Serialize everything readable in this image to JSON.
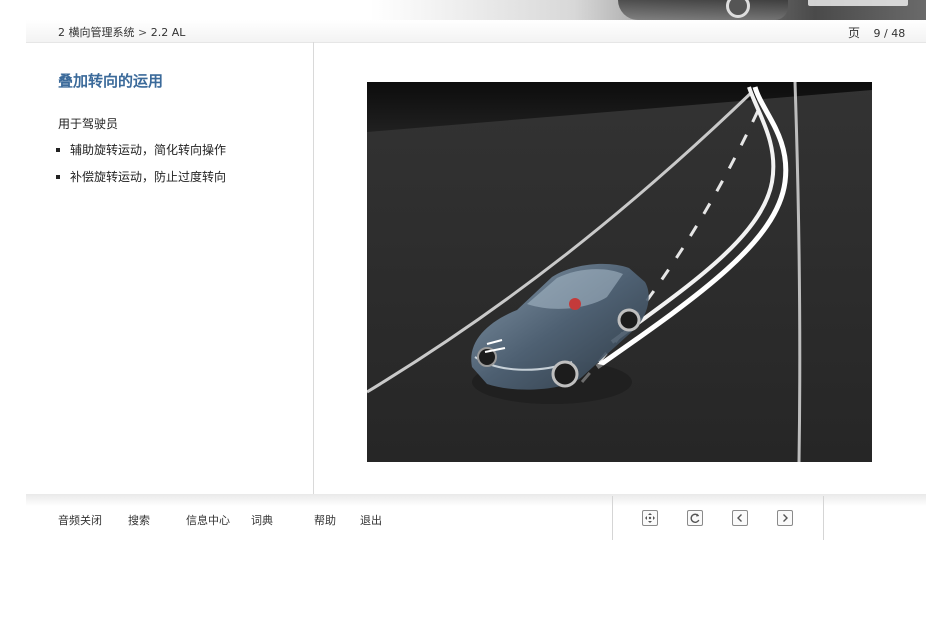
{
  "breadcrumb": {
    "section": "2 横向管理系统",
    "separator": ">",
    "current": "2.2 AL"
  },
  "page_indicator": {
    "label": "页",
    "current": "9",
    "divider": "/",
    "total": "48"
  },
  "content": {
    "title": "叠加转向的运用",
    "intro": "用于驾驶员",
    "bullets": [
      "辅助旋转运动，简化转向操作",
      "补偿旋转运动，防止过度转向"
    ]
  },
  "footer": {
    "links": [
      "音频关闭",
      "搜索",
      "信息中心",
      "词典",
      "帮助",
      "退出"
    ],
    "controls": [
      "move-icon",
      "refresh-icon",
      "chevron-left-icon",
      "chevron-right-icon"
    ]
  },
  "colors": {
    "title": "#3b6a9a",
    "road": "#2b2b2b",
    "lane_line": "#ffffff"
  }
}
